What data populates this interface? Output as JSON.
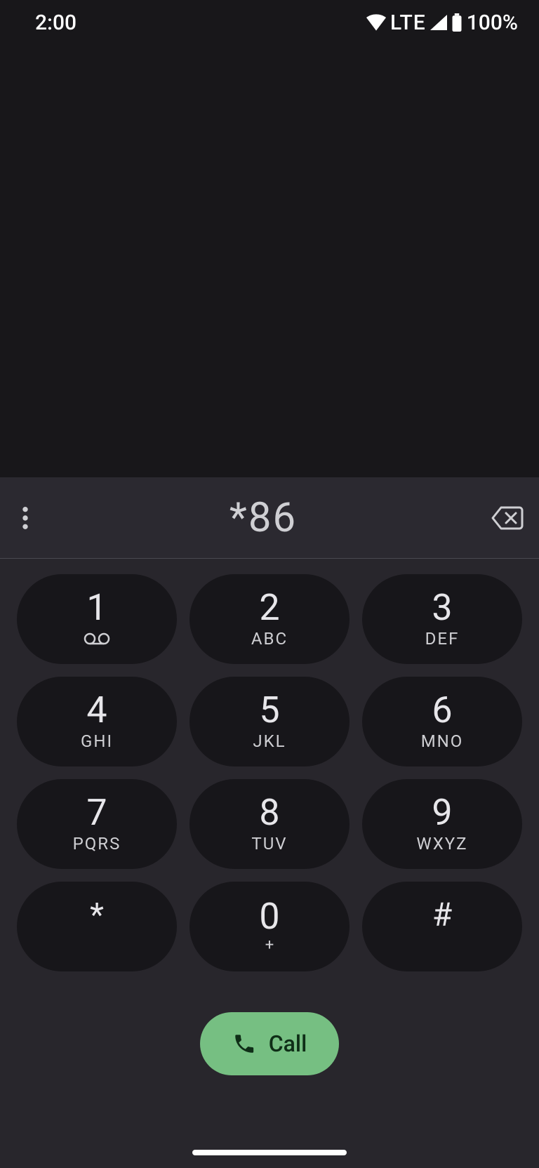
{
  "status": {
    "time": "2:00",
    "network_label": "LTE",
    "battery_text": "100%"
  },
  "dialer": {
    "entered_number": "*86",
    "call_label": "Call",
    "keys": [
      {
        "digit": "1",
        "letters": ""
      },
      {
        "digit": "2",
        "letters": "ABC"
      },
      {
        "digit": "3",
        "letters": "DEF"
      },
      {
        "digit": "4",
        "letters": "GHI"
      },
      {
        "digit": "5",
        "letters": "JKL"
      },
      {
        "digit": "6",
        "letters": "MNO"
      },
      {
        "digit": "7",
        "letters": "PQRS"
      },
      {
        "digit": "8",
        "letters": "TUV"
      },
      {
        "digit": "9",
        "letters": "WXYZ"
      },
      {
        "digit": "*",
        "letters": ""
      },
      {
        "digit": "0",
        "letters": "+"
      },
      {
        "digit": "#",
        "letters": ""
      }
    ]
  }
}
